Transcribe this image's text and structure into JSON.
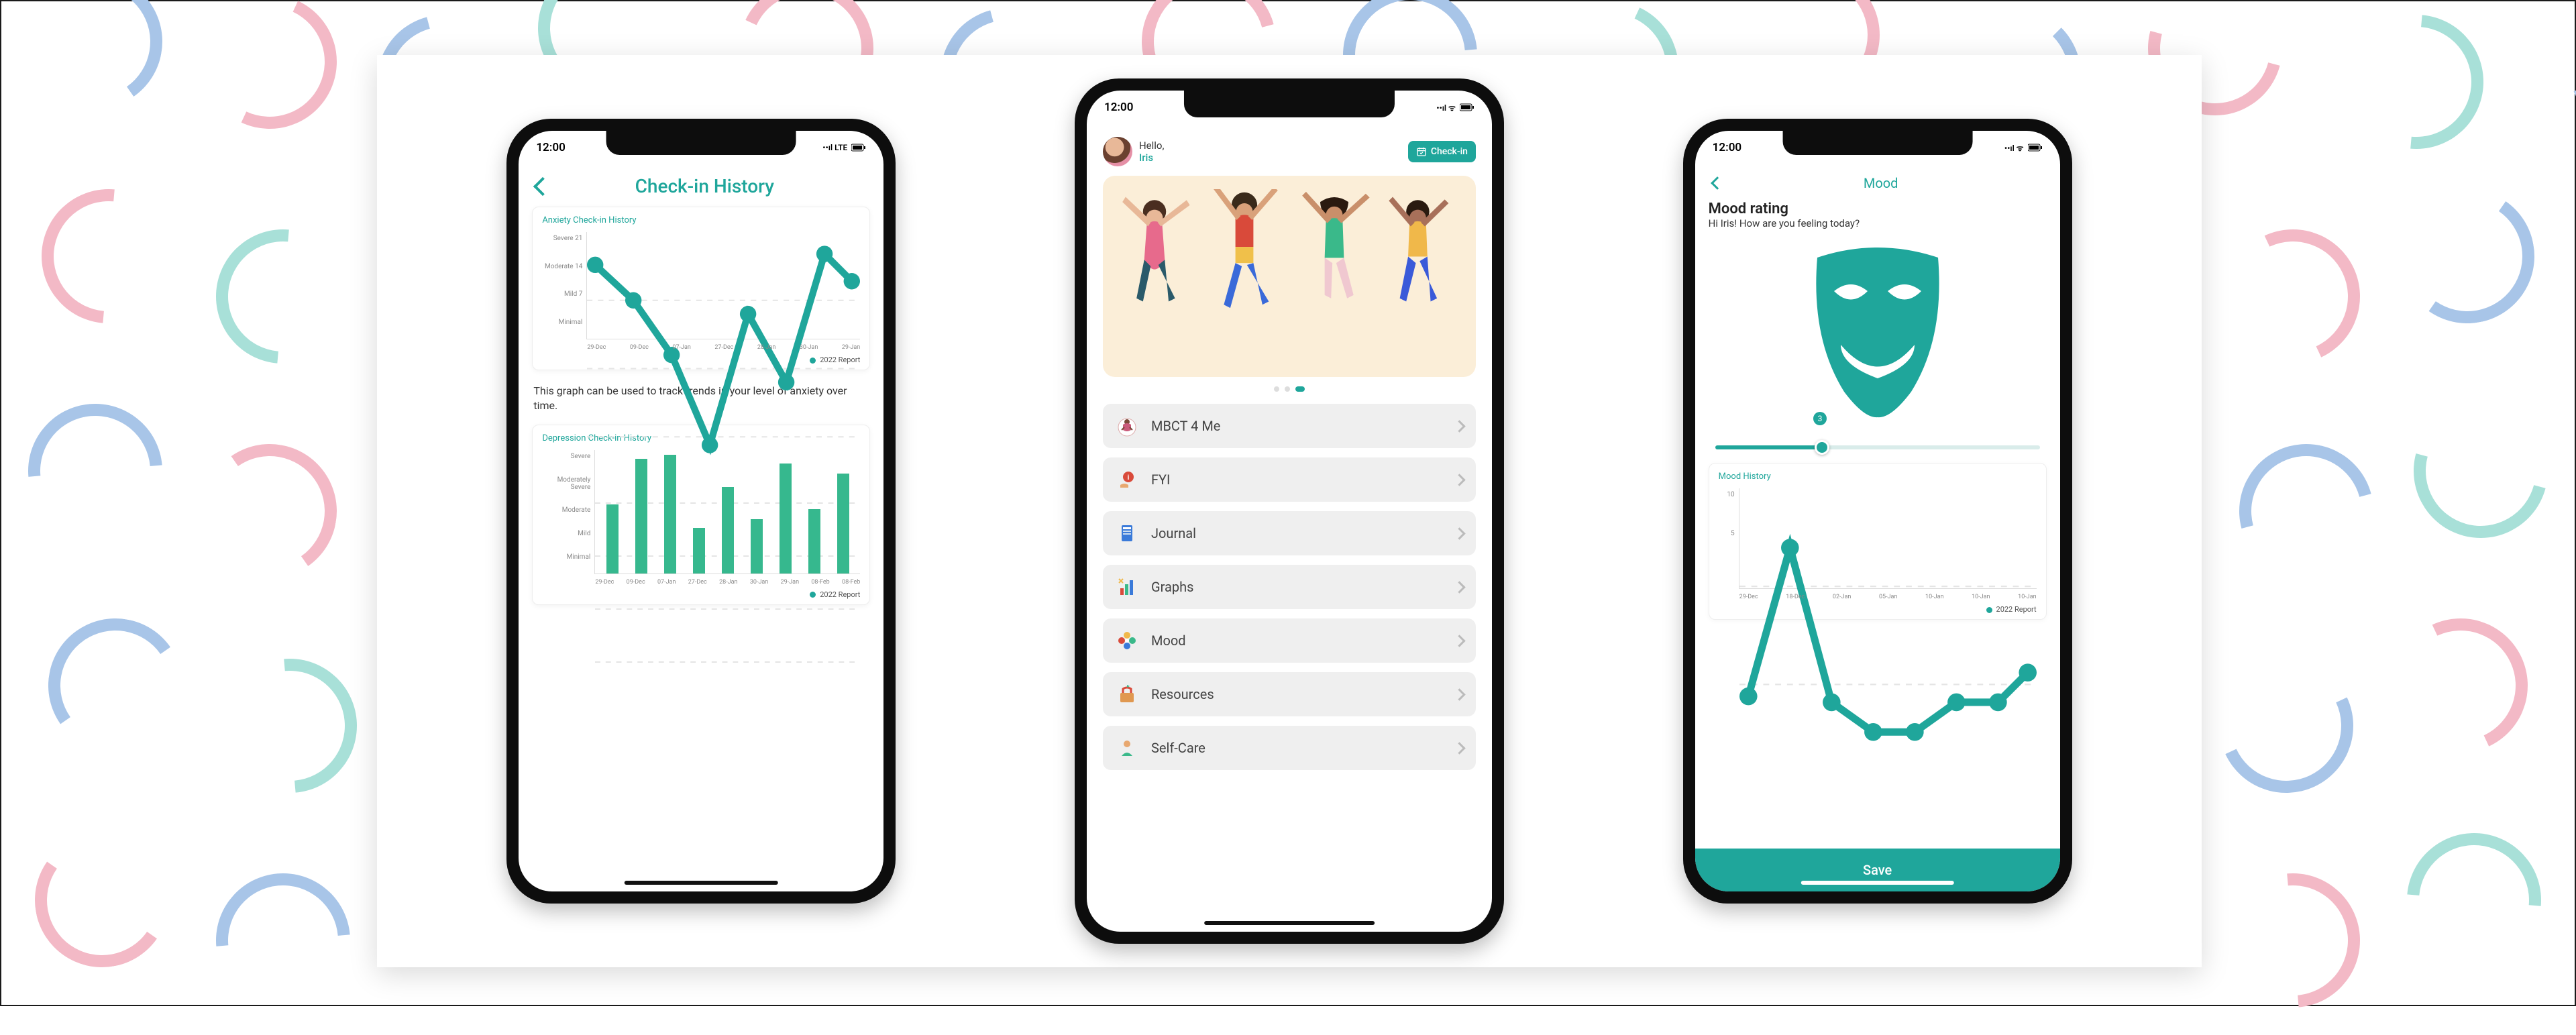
{
  "status": {
    "time": "12:00",
    "network_left": "••ıl LTE",
    "network_right": "••ıl ᯤ"
  },
  "phone_history": {
    "nav_title": "Check-in History",
    "anxiety_chart_title": "Anxiety Check-in History",
    "description": "This graph can be used to track trends in your level of anxiety over time.",
    "depression_chart_title": "Depression Check-in History",
    "y_labels_anxiety": {
      "a": "Severe",
      "b": "Moderate",
      "c": "Mild",
      "d": "Minimal"
    },
    "y_vals_anxiety": {
      "a": "21",
      "b": "14",
      "c": "7"
    },
    "y_labels_depression": {
      "a": "Severe",
      "b": "Moderately Severe",
      "c": "Moderate",
      "d": "Mild",
      "e": "Minimal"
    },
    "x_labels": {
      "a": "29-Dec",
      "b": "09-Dec",
      "c": "07-Jan",
      "d": "27-Dec",
      "e": "28-Jan",
      "f": "30-Jan",
      "g": "29-Jan",
      "h": "08-Feb",
      "i": "08-Feb"
    },
    "legend": "2022 Report"
  },
  "phone_home": {
    "greeting_label": "Hello,",
    "greeting_name": "Iris",
    "checkin_btn": "Check-in",
    "menu": {
      "mbct": "MBCT 4 Me",
      "fyi": "FYI",
      "journal": "Journal",
      "graphs": "Graphs",
      "mood": "Mood",
      "resources": "Resources",
      "selfcare": "Self-Care"
    }
  },
  "phone_mood": {
    "nav_title": "Mood",
    "heading": "Mood rating",
    "subheading": "Hi Iris! How are you feeling today?",
    "slider_value": "3",
    "chart_title": "Mood History",
    "y_labels": {
      "a": "10",
      "b": "5"
    },
    "x_labels": {
      "a": "29-Dec",
      "b": "18-Dec",
      "c": "02-Jan",
      "d": "05-Jan",
      "e": "10-Jan",
      "f": "10-Jan",
      "g": "10-Jan"
    },
    "legend": "2022 Report",
    "save_label": "Save"
  },
  "chart_data": [
    {
      "type": "line",
      "title": "Anxiety Check-in History",
      "categories": [
        "29-Dec",
        "09-Dec",
        "07-Jan",
        "27-Dec",
        "28-Jan",
        "30-Jan",
        "29-Jan"
      ],
      "values": [
        19,
        16,
        12,
        5,
        15,
        10,
        20,
        18
      ],
      "y_tick_labels": [
        "Severe",
        "Moderate",
        "Mild",
        "Minimal"
      ],
      "y_tick_values": [
        21,
        14,
        7
      ],
      "ylim": [
        0,
        21
      ],
      "legend": [
        "2022 Report"
      ]
    },
    {
      "type": "bar",
      "title": "Depression Check-in History",
      "categories": [
        "29-Dec",
        "09-Dec",
        "07-Jan",
        "27-Dec",
        "28-Jan",
        "30-Jan",
        "29-Jan",
        "08-Feb",
        "08-Feb"
      ],
      "values": [
        15,
        25,
        26,
        10,
        19,
        12,
        24,
        14,
        22
      ],
      "y_tick_labels": [
        "Severe",
        "Moderately Severe",
        "Moderate",
        "Mild",
        "Minimal"
      ],
      "ylim": [
        0,
        27
      ],
      "legend": [
        "2022 Report"
      ]
    },
    {
      "type": "line",
      "title": "Mood History",
      "categories": [
        "29-Dec",
        "18-Dec",
        "02-Jan",
        "05-Jan",
        "10-Jan",
        "10-Jan",
        "10-Jan"
      ],
      "values": [
        3,
        8,
        3,
        2,
        2,
        3,
        3,
        4
      ],
      "y_tick_values": [
        10,
        5
      ],
      "ylim": [
        0,
        10
      ],
      "legend": [
        "2022 Report"
      ]
    }
  ]
}
